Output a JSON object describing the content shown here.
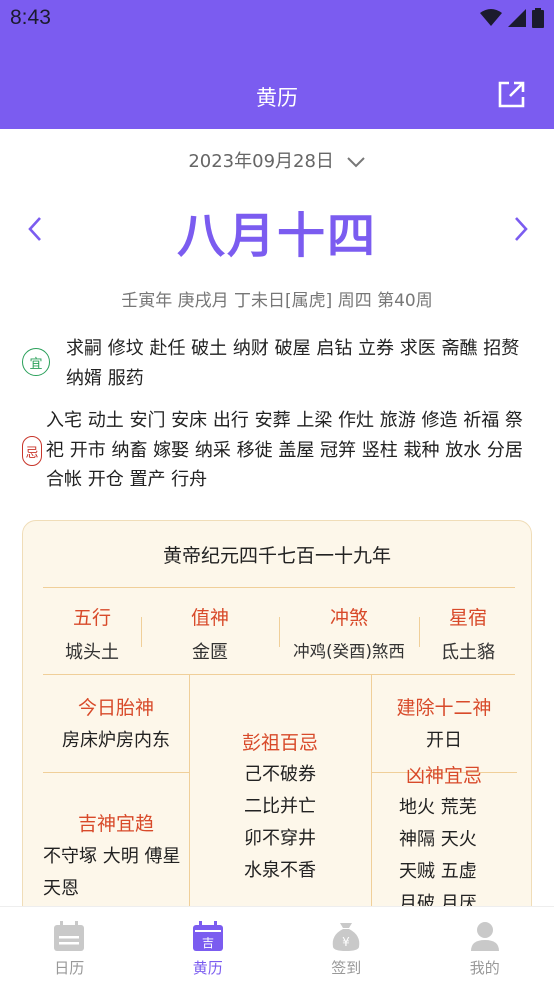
{
  "status": {
    "time": "8:43"
  },
  "header": {
    "title": "黄历"
  },
  "date": {
    "solar": "2023年09月28日"
  },
  "lunar": {
    "day": "八月十四"
  },
  "ganzhi": "壬寅年 庚戌月 丁未日[属虎] 周四 第40周",
  "yi": {
    "badge": "宜",
    "text": "求嗣 修坟 赴任 破土 纳财 破屋 启钻 立券 求医 斋醮 招赘 纳婿 服药"
  },
  "ji": {
    "badge": "忌",
    "text": "入宅 动土 安门 安床 出行 安葬 上梁 作灶 旅游 修造 祈福 祭祀 开市 纳畜 嫁娶 纳采 移徙 盖屋 冠笄 竖柱 栽种 放水 分居 合帐 开仓 置产 行舟"
  },
  "card": {
    "title": "黄帝纪元四千七百一十九年",
    "row1": [
      {
        "h": "五行",
        "v": "城头土"
      },
      {
        "h": "值神",
        "v": "金匮"
      },
      {
        "h": "冲煞",
        "v": "冲鸡(癸酉)煞西"
      },
      {
        "h": "星宿",
        "v": "氐土貉"
      }
    ],
    "taishen": {
      "h": "今日胎神",
      "v": "房床炉房内东"
    },
    "pengzu": {
      "h": "彭祖百忌",
      "lines": [
        "己不破券",
        "二比并亡",
        "卯不穿井",
        "水泉不香"
      ]
    },
    "jianchu": {
      "h": "建除十二神",
      "v": "开日"
    },
    "jishen": {
      "h": "吉神宜趋",
      "v": "不守塚 大明 傅星 天恩"
    },
    "xiongshen": {
      "h": "凶神宜忌",
      "lines": [
        "地火 荒芜",
        "神隔 天火",
        "天贼 五虚",
        "月破 月厌"
      ]
    }
  },
  "tabs": [
    {
      "label": "日历",
      "icon": "calendar-icon"
    },
    {
      "label": "黄历",
      "icon": "almanac-icon",
      "active": true
    },
    {
      "label": "签到",
      "icon": "money-bag-icon"
    },
    {
      "label": "我的",
      "icon": "person-icon"
    }
  ],
  "colors": {
    "accent": "#7b5cf0",
    "good": "#2aa05a",
    "bad": "#c8352a",
    "card": "#fdf7ea"
  }
}
